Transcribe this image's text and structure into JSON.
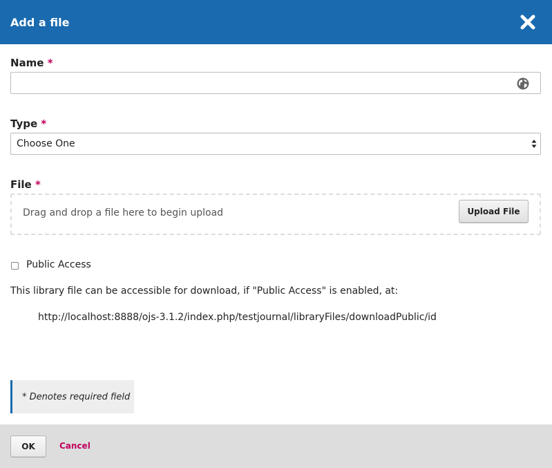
{
  "modal": {
    "title": "Add a file"
  },
  "fields": {
    "name": {
      "label": "Name",
      "required_mark": "*",
      "value": ""
    },
    "type": {
      "label": "Type",
      "required_mark": "*",
      "selected": "Choose One"
    },
    "file": {
      "label": "File",
      "required_mark": "*",
      "drop_text": "Drag and drop a file here to begin upload",
      "upload_label": "Upload File"
    }
  },
  "public_access": {
    "label": "Public Access",
    "checked": false,
    "info": "This library file can be accessible for download, if \"Public Access\" is enabled, at:",
    "url": "http://localhost:8888/ojs-3.1.2/index.php/testjournal/libraryFiles/downloadPublic/id"
  },
  "notice": {
    "text": "* Denotes required field"
  },
  "footer": {
    "ok_label": "OK",
    "cancel_label": "Cancel"
  },
  "colors": {
    "header_bg": "#1a6aaf",
    "required": "#c0005d",
    "footer_bg": "#dddddd"
  },
  "icons": {
    "close": "close-icon",
    "globe": "globe-icon",
    "select_arrows": "select-arrows-icon"
  }
}
